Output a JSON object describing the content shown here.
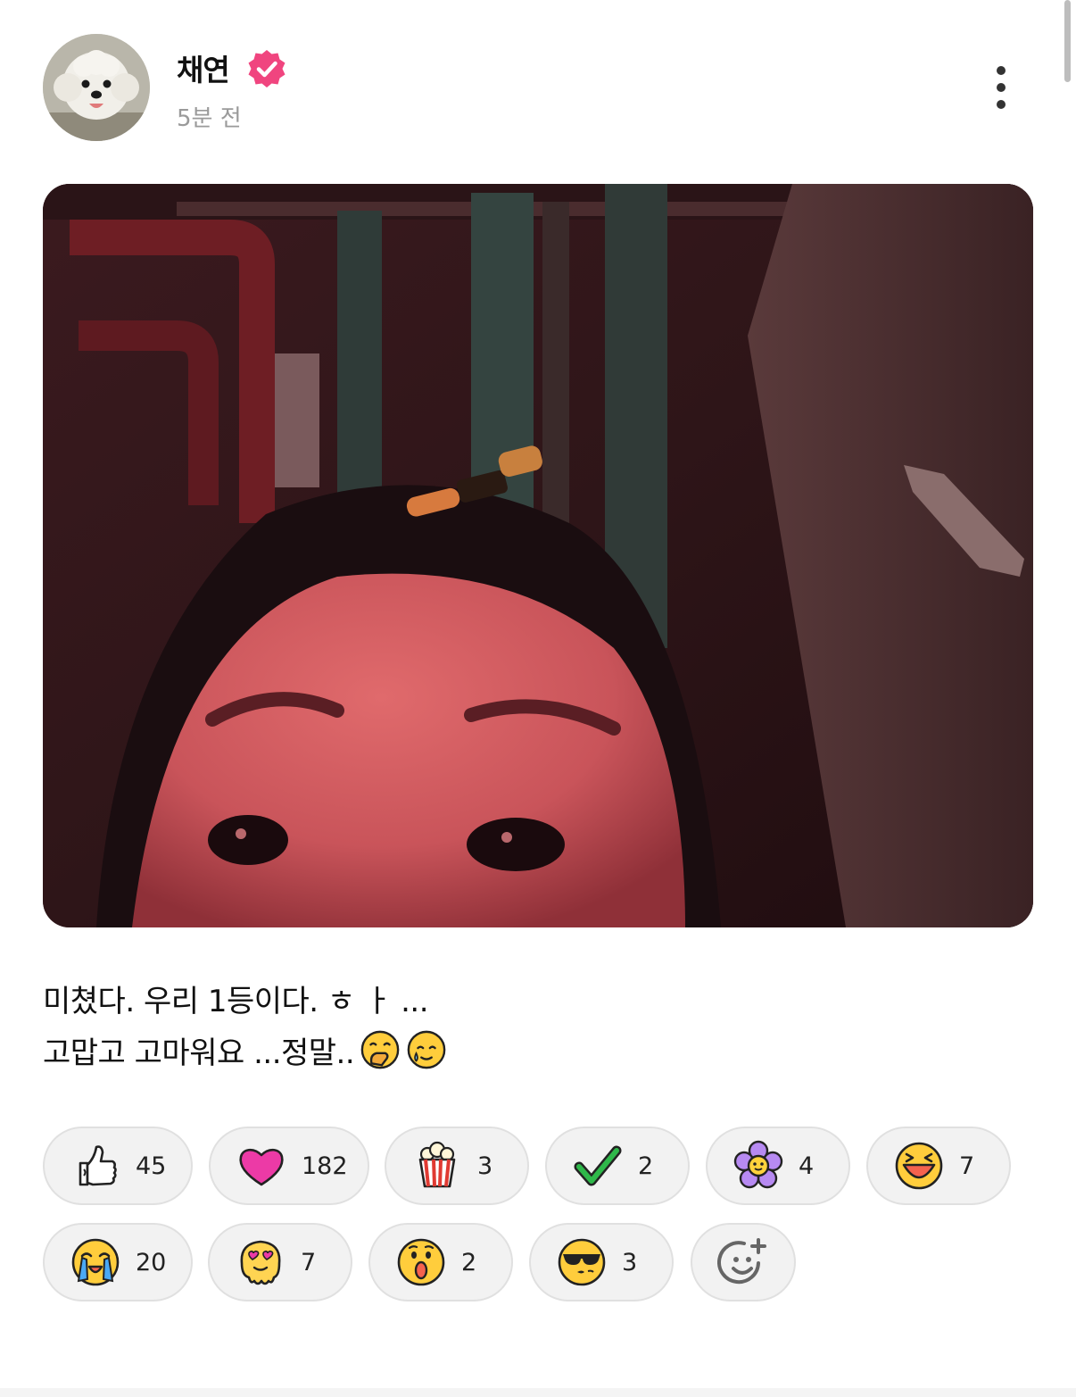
{
  "post": {
    "author": "채연",
    "timestamp": "5분 전",
    "verified_color": "#f0457f",
    "avatar_icon": "dog-avatar",
    "more_icon": "more-vertical-icon",
    "caption_lines": [
      "미쳤다. 우리 1등이다. ㅎ ㅏ ...",
      "고맙고 고마워요 ...정말.."
    ],
    "caption_emojis": [
      "hand-over-mouth-emoji",
      "smiling-tear-emoji"
    ]
  },
  "reactions": [
    {
      "icon": "thumbs-up-icon",
      "count": "45"
    },
    {
      "icon": "heart-icon",
      "count": "182"
    },
    {
      "icon": "popcorn-icon",
      "count": "3"
    },
    {
      "icon": "check-icon",
      "count": "2"
    },
    {
      "icon": "flower-icon",
      "count": "4"
    },
    {
      "icon": "laughing-face-icon",
      "count": "7"
    },
    {
      "icon": "crying-face-icon",
      "count": "20"
    },
    {
      "icon": "melting-heart-eyes-icon",
      "count": "7"
    },
    {
      "icon": "surprised-face-icon",
      "count": "2"
    },
    {
      "icon": "cool-face-icon",
      "count": "3"
    }
  ],
  "add_reaction_icon": "add-reaction-icon"
}
